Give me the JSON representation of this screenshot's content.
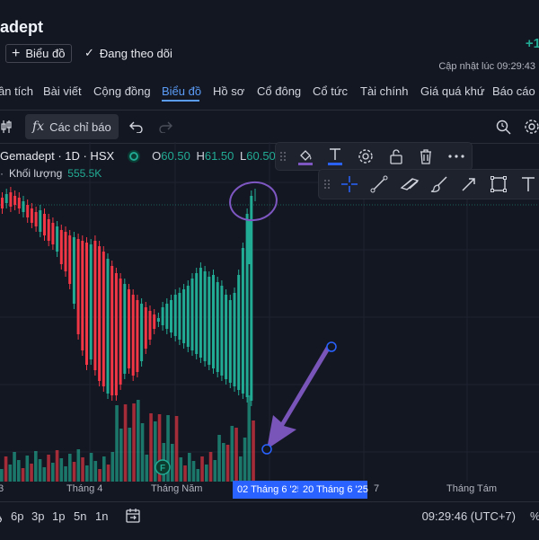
{
  "header": {
    "title": "adept",
    "change": "+1",
    "updated_label": "Cập nhật lúc",
    "updated_time": "09:29:43",
    "chart_button": "Biểu đồ",
    "watch_button": "Đang theo dõi"
  },
  "nav": {
    "items": [
      "ân tích",
      "Bài viết",
      "Cộng đồng",
      "Biểu đồ",
      "Hồ sơ",
      "Cổ đông",
      "Cổ tức",
      "Tài chính",
      "Giá quá khứ",
      "Báo cáo"
    ],
    "active": "Biểu đồ"
  },
  "toolbar": {
    "indicators_label": "Các chỉ báo",
    "fx_glyph": "fx"
  },
  "legend": {
    "symbol": "Gemadept · 1D · HSX",
    "o_label": "O",
    "o_value": "60.50",
    "h_label": "H",
    "h_value": "61.50",
    "l_label": "L",
    "l_value": "60.50",
    "volume_label": "Khối lượng",
    "volume_value": "555.5K",
    "marker": "F"
  },
  "time_axis": {
    "labels": [
      "3",
      "Tháng 4",
      "Tháng Năm",
      "7",
      "Tháng Tám"
    ],
    "highlight_start": "02 Tháng 6 '25",
    "highlight_end": "20 Tháng 6 '25"
  },
  "bottom": {
    "ranges": [
      "6p",
      "3p",
      "1p",
      "5n",
      "1n"
    ],
    "clock": "09:29:46 (UTC+7)",
    "percent": "%"
  },
  "colors": {
    "up": "#22ab94",
    "down": "#f23645",
    "accent": "#2962ff",
    "annotation": "#7e57c2"
  }
}
